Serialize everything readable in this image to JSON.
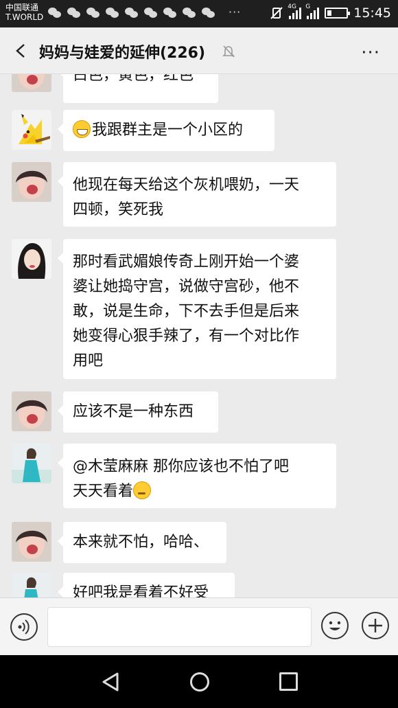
{
  "status_bar": {
    "carrier_line1": "中国联通",
    "carrier_line2": "T.WORLD",
    "dots": "···",
    "network_4g": "4G",
    "network_g": "G",
    "time": "15:45"
  },
  "header": {
    "title": "妈妈与娃爱的延伸(226)",
    "more": "···"
  },
  "messages": [
    {
      "text": "白色，黄色，红色"
    },
    {
      "text": "我跟群主是一个小区的"
    },
    {
      "text_line1": "他现在每天给这个灰机喂奶，一天",
      "text_line2": "四顿，笑死我"
    },
    {
      "text_line1": "那时看武媚娘传奇上刚开始一个婆",
      "text_line2": "婆让她捣守宫，说做守宫砂，他不",
      "text_line3": "敢，说是生命，下不去手但是后来",
      "text_line4": "她变得心狠手辣了，有一个对比作",
      "text_line5": "用吧"
    },
    {
      "text": "应该不是一种东西"
    },
    {
      "text_line1": "@木莹麻麻  那你应该也不怕了吧",
      "text_line2": "天天看着"
    },
    {
      "text": "本来就不怕，哈哈、"
    },
    {
      "text": "好吧我是看着不好受"
    }
  ],
  "colors": {
    "status_bar_bg": "#1f1f1f",
    "header_bg": "#efefef",
    "chat_bg": "#ebebeb",
    "bubble_bg": "#ffffff",
    "nav_bg": "#000000"
  },
  "icons": {
    "back": "chevron-left-icon",
    "mute": "bell-muted-icon",
    "voice": "voice-icon",
    "emoji": "smile-icon",
    "plus": "plus-icon"
  }
}
